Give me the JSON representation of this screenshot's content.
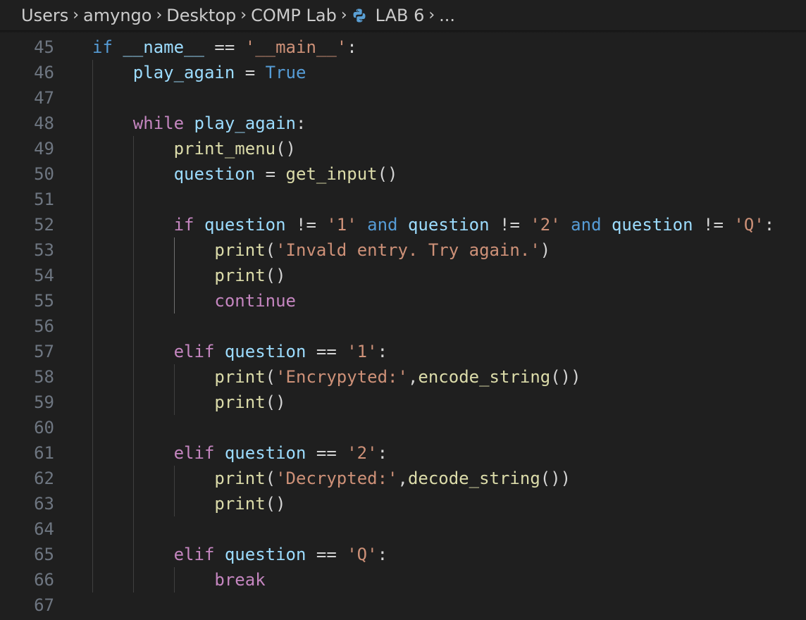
{
  "breadcrumb": {
    "items": [
      "Users",
      "amyngo",
      "Desktop",
      "COMP Lab",
      "LAB 6",
      "..."
    ],
    "file_icon": "python-icon"
  },
  "editor": {
    "lines": [
      {
        "n": "45",
        "indent": 0,
        "tokens": [
          [
            "kw2",
            "if"
          ],
          [
            "op",
            " "
          ],
          [
            "var",
            "__name__"
          ],
          [
            "op",
            " == "
          ],
          [
            "str",
            "'__main__'"
          ],
          [
            "op",
            ":"
          ]
        ]
      },
      {
        "n": "46",
        "indent": 1,
        "tokens": [
          [
            "var",
            "play_again"
          ],
          [
            "op",
            " = "
          ],
          [
            "kw2",
            "True"
          ]
        ]
      },
      {
        "n": "47",
        "indent": 0,
        "tokens": []
      },
      {
        "n": "48",
        "indent": 1,
        "tokens": [
          [
            "kw",
            "while"
          ],
          [
            "op",
            " "
          ],
          [
            "var",
            "play_again"
          ],
          [
            "op",
            ":"
          ]
        ]
      },
      {
        "n": "49",
        "indent": 2,
        "tokens": [
          [
            "fn",
            "print_menu"
          ],
          [
            "op",
            "()"
          ]
        ]
      },
      {
        "n": "50",
        "indent": 2,
        "tokens": [
          [
            "var",
            "question"
          ],
          [
            "op",
            " = "
          ],
          [
            "fn",
            "get_input"
          ],
          [
            "op",
            "()"
          ]
        ]
      },
      {
        "n": "51",
        "indent": 0,
        "tokens": []
      },
      {
        "n": "52",
        "indent": 2,
        "tokens": [
          [
            "kw",
            "if"
          ],
          [
            "op",
            " "
          ],
          [
            "var",
            "question"
          ],
          [
            "op",
            " != "
          ],
          [
            "str",
            "'1'"
          ],
          [
            "op",
            " "
          ],
          [
            "kw2",
            "and"
          ],
          [
            "op",
            " "
          ],
          [
            "var",
            "question"
          ],
          [
            "op",
            " != "
          ],
          [
            "str",
            "'2'"
          ],
          [
            "op",
            " "
          ],
          [
            "kw2",
            "and"
          ],
          [
            "op",
            " "
          ],
          [
            "var",
            "question"
          ],
          [
            "op",
            " != "
          ],
          [
            "str",
            "'Q'"
          ],
          [
            "op",
            ":"
          ]
        ]
      },
      {
        "n": "53",
        "indent": 3,
        "tokens": [
          [
            "fn",
            "print"
          ],
          [
            "op",
            "("
          ],
          [
            "str",
            "'Invald entry. Try again.'"
          ],
          [
            "op",
            ")"
          ]
        ]
      },
      {
        "n": "54",
        "indent": 3,
        "tokens": [
          [
            "fn",
            "print"
          ],
          [
            "op",
            "()"
          ]
        ]
      },
      {
        "n": "55",
        "indent": 3,
        "tokens": [
          [
            "kw",
            "continue"
          ]
        ]
      },
      {
        "n": "56",
        "indent": 0,
        "tokens": []
      },
      {
        "n": "57",
        "indent": 2,
        "tokens": [
          [
            "kw",
            "elif"
          ],
          [
            "op",
            " "
          ],
          [
            "var",
            "question"
          ],
          [
            "op",
            " == "
          ],
          [
            "str",
            "'1'"
          ],
          [
            "op",
            ":"
          ]
        ]
      },
      {
        "n": "58",
        "indent": 3,
        "tokens": [
          [
            "fn",
            "print"
          ],
          [
            "op",
            "("
          ],
          [
            "str",
            "'Encrypyted:'"
          ],
          [
            "op",
            ","
          ],
          [
            "fn",
            "encode_string"
          ],
          [
            "op",
            "())"
          ]
        ]
      },
      {
        "n": "59",
        "indent": 3,
        "tokens": [
          [
            "fn",
            "print"
          ],
          [
            "op",
            "()"
          ]
        ]
      },
      {
        "n": "60",
        "indent": 0,
        "tokens": []
      },
      {
        "n": "61",
        "indent": 2,
        "tokens": [
          [
            "kw",
            "elif"
          ],
          [
            "op",
            " "
          ],
          [
            "var",
            "question"
          ],
          [
            "op",
            " == "
          ],
          [
            "str",
            "'2'"
          ],
          [
            "op",
            ":"
          ]
        ]
      },
      {
        "n": "62",
        "indent": 3,
        "tokens": [
          [
            "fn",
            "print"
          ],
          [
            "op",
            "("
          ],
          [
            "str",
            "'Decrypted:'"
          ],
          [
            "op",
            ","
          ],
          [
            "fn",
            "decode_string"
          ],
          [
            "op",
            "())"
          ]
        ]
      },
      {
        "n": "63",
        "indent": 3,
        "tokens": [
          [
            "fn",
            "print"
          ],
          [
            "op",
            "()"
          ]
        ]
      },
      {
        "n": "64",
        "indent": 0,
        "tokens": []
      },
      {
        "n": "65",
        "indent": 2,
        "tokens": [
          [
            "kw",
            "elif"
          ],
          [
            "op",
            " "
          ],
          [
            "var",
            "question"
          ],
          [
            "op",
            " == "
          ],
          [
            "str",
            "'Q'"
          ],
          [
            "op",
            ":"
          ]
        ]
      },
      {
        "n": "66",
        "indent": 3,
        "tokens": [
          [
            "kw",
            "break"
          ]
        ]
      },
      {
        "n": "67",
        "indent": 0,
        "tokens": []
      }
    ]
  }
}
